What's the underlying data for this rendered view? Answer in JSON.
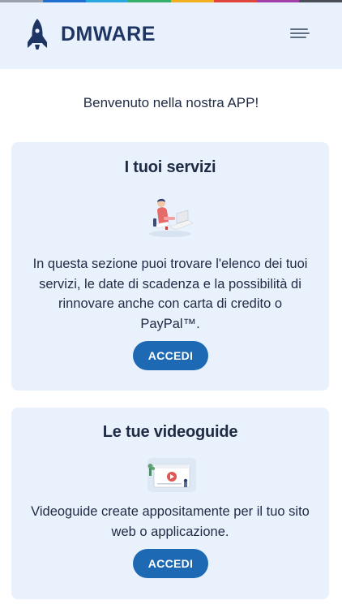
{
  "header": {
    "brand": "DMWARE",
    "logo_icon": "rocket-icon",
    "menu_icon": "hamburger-menu-icon"
  },
  "welcome": "Benvenuto nella nostra APP!",
  "cards": [
    {
      "title": "I tuoi servizi",
      "illustration": "person-at-desk-illustration",
      "text": "In questa sezione puoi trovare l'elenco dei tuoi servizi, le date di scadenza e la possibilità di rinnovare anche con carta di credito o PayPal™.",
      "button": "ACCEDI"
    },
    {
      "title": "Le tue videoguide",
      "illustration": "video-player-illustration",
      "text": "Videoguide create appositamente per il tuo sito web o applicazione.",
      "button": "ACCEDI"
    }
  ],
  "colors": {
    "header_bg": "#e9f2fc",
    "card_bg": "#e9f2fc",
    "brand": "#1e3564",
    "button": "#1e69b4",
    "text": "#1f2a44"
  }
}
